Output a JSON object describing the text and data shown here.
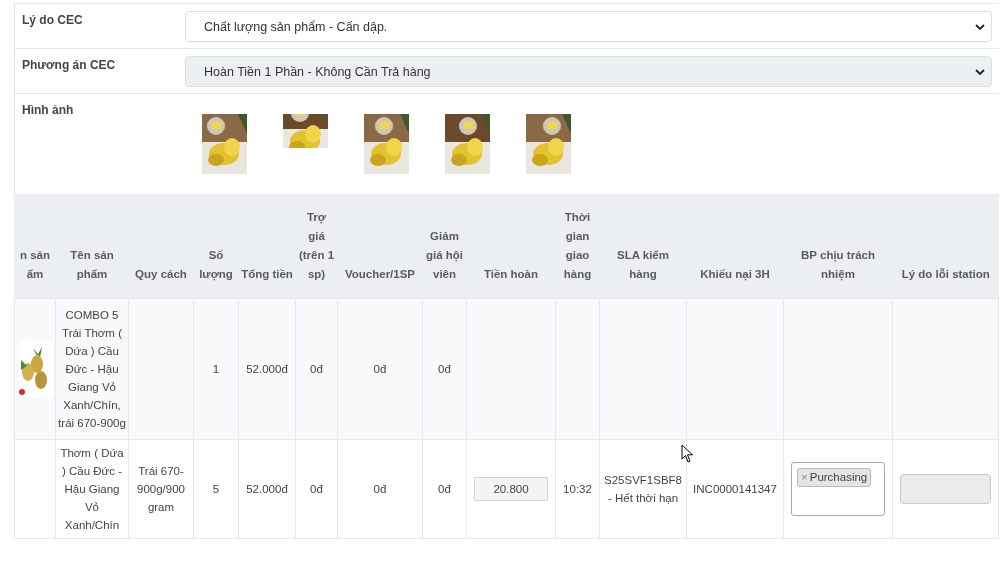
{
  "form": [
    {
      "label": "Lý do CEC",
      "value": "Chất lượng sản phẩm - Cấn dập.",
      "disabled": false
    },
    {
      "label": "Phương án CEC",
      "value": "Hoàn Tiền 1 Phần - Không Cần Trả hàng",
      "disabled": true
    }
  ],
  "images": {
    "label": "Hình ảnh",
    "items": [
      {
        "kind": "picture"
      },
      {
        "kind": "picture"
      },
      {
        "kind": "picture"
      },
      {
        "kind": "picture"
      },
      {
        "kind": "picture"
      }
    ]
  },
  "table": {
    "columns": [
      "n sản ẩm",
      "Tên sản phẩm",
      "Quy cách",
      "Số lượng",
      "Tổng tiền",
      "Trợ giá (trên 1 sp)",
      "Voucher/1SP",
      "Giảm giá hội viên",
      "Tiền hoàn",
      "Thời gian giao hàng",
      "SLA kiểm hàng",
      "Khiếu nại 3H",
      "BP chịu trách nhiệm",
      "Lý do lỗi station"
    ],
    "rows": [
      {
        "cells": [
          {
            "kind": "picture"
          },
          {
            "kind": "text",
            "text": "COMBO 5 Trái Thơm ( Dứa ) Cầu Đức - Hậu Giang Vỏ Xanh/Chín, trái 670-900g"
          },
          {
            "kind": "empty"
          },
          {
            "kind": "text",
            "text": "1"
          },
          {
            "kind": "text",
            "text": "52.000đ"
          },
          {
            "kind": "text",
            "text": "0đ"
          },
          {
            "kind": "text",
            "text": "0đ"
          },
          {
            "kind": "text",
            "text": "0đ"
          },
          {
            "kind": "empty"
          },
          {
            "kind": "empty"
          },
          {
            "kind": "empty"
          },
          {
            "kind": "empty"
          },
          {
            "kind": "empty"
          },
          {
            "kind": "empty"
          }
        ]
      },
      {
        "cells": [
          {
            "kind": "empty"
          },
          {
            "kind": "text",
            "text": "Thơm ( Dứa ) Cầu Đức - Hậu Giang Vỏ Xanh/Chín"
          },
          {
            "kind": "text",
            "text": "Trái 670-900g/900 gram"
          },
          {
            "kind": "text",
            "text": "5"
          },
          {
            "kind": "text",
            "text": "52.000đ"
          },
          {
            "kind": "text",
            "text": "0đ"
          },
          {
            "kind": "text",
            "text": "0đ"
          },
          {
            "kind": "text",
            "text": "0đ"
          },
          {
            "kind": "input",
            "value": "20.800",
            "disabled": false
          },
          {
            "kind": "text",
            "text": "10:32"
          },
          {
            "kind": "text",
            "text": "S25SVF1SBF8 - Hết thời hạn"
          },
          {
            "kind": "text",
            "text": "INC0000141347"
          },
          {
            "kind": "tags",
            "tags": [
              {
                "remove": "×",
                "label": "Purchasing"
              }
            ]
          },
          {
            "kind": "input",
            "disabled": true
          }
        ]
      }
    ]
  }
}
